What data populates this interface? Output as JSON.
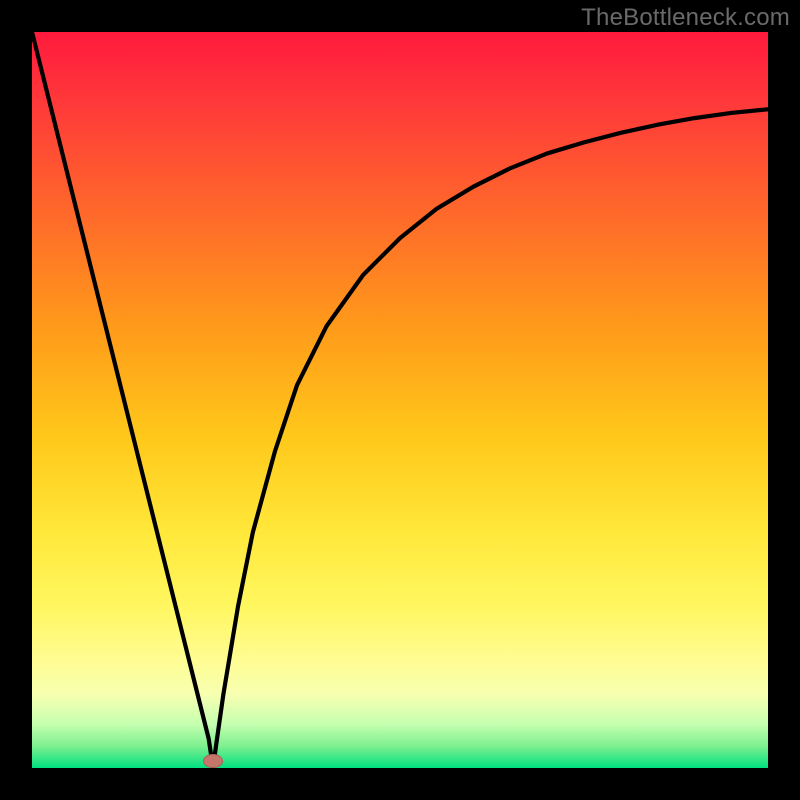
{
  "watermark": "TheBottleneck.com",
  "gradient_colors": {
    "top": "#ff1a3d",
    "mid1": "#ff9a1a",
    "mid2": "#ffe83a",
    "bottom": "#00e080"
  },
  "marker": {
    "x_pct": 24.6,
    "y_pct": 99.0,
    "color": "#c5766b"
  },
  "chart_data": {
    "type": "line",
    "title": "",
    "xlabel": "",
    "ylabel": "",
    "xlim": [
      0,
      100
    ],
    "ylim": [
      0,
      100
    ],
    "series": [
      {
        "name": "bottleneck-curve",
        "x": [
          0,
          5,
          10,
          15,
          20,
          22,
          24,
          24.6,
          25,
          26,
          28,
          30,
          33,
          36,
          40,
          45,
          50,
          55,
          60,
          65,
          70,
          75,
          80,
          85,
          90,
          95,
          100
        ],
        "values": [
          100,
          80,
          60,
          40,
          20,
          12,
          4,
          0,
          3,
          10,
          22,
          32,
          43,
          52,
          60,
          67,
          72,
          76,
          79,
          81.5,
          83.5,
          85,
          86.3,
          87.4,
          88.3,
          89,
          89.5
        ]
      }
    ],
    "annotations": [
      {
        "type": "marker",
        "x": 24.6,
        "y": 0,
        "label": "minimum-point"
      }
    ],
    "grid": false,
    "legend": false
  }
}
